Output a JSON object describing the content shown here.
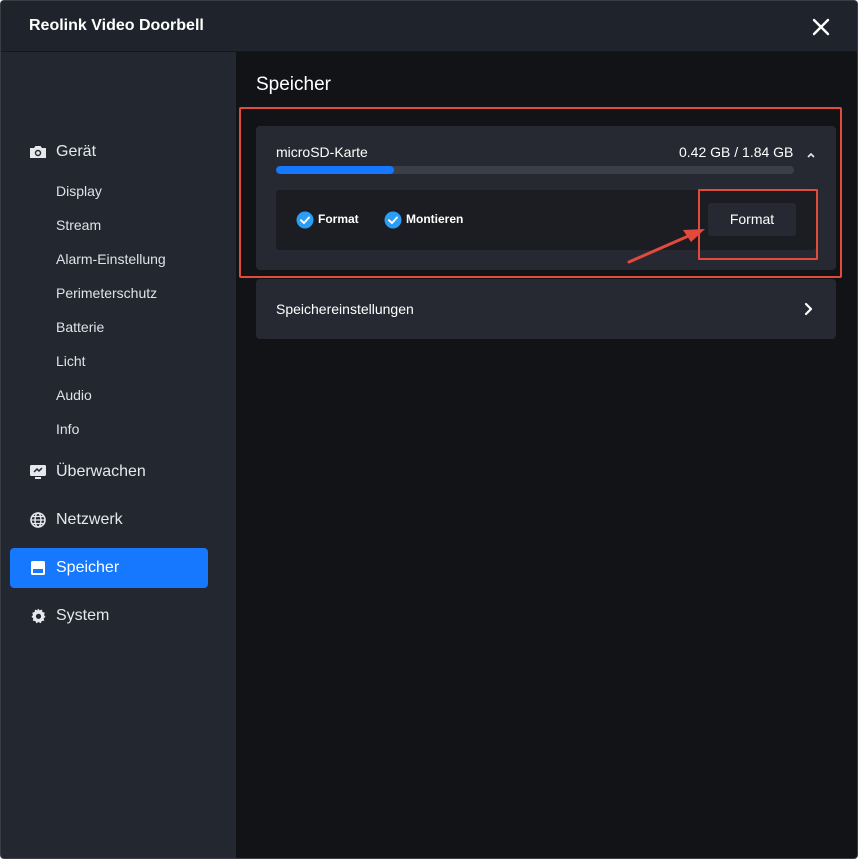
{
  "window": {
    "title": "Reolink Video Doorbell"
  },
  "sidebar": {
    "sections": [
      {
        "label": "Gerät",
        "icon": "camera-icon"
      },
      {
        "label": "Überwachen",
        "icon": "monitor-icon"
      },
      {
        "label": "Netzwerk",
        "icon": "globe-icon"
      },
      {
        "label": "Speicher",
        "icon": "storage-icon",
        "active": true
      },
      {
        "label": "System",
        "icon": "gear-icon"
      }
    ],
    "device_items": [
      "Display",
      "Stream",
      "Alarm-Einstellung",
      "Perimeterschutz",
      "Batterie",
      "Licht",
      "Audio",
      "Info"
    ]
  },
  "main": {
    "title": "Speicher",
    "sd_card": {
      "label": "microSD-Karte",
      "usage": "0.42 GB / 1.84 GB",
      "used_fraction": 0.228,
      "options": [
        {
          "label": "Format",
          "checked": true
        },
        {
          "label": "Montieren",
          "checked": true
        }
      ],
      "format_button": "Format"
    },
    "settings_row": {
      "label": "Speichereinstellungen"
    }
  },
  "colors": {
    "accent": "#1677ff",
    "annotation": "#e24a3b",
    "check": "#2a9df4"
  }
}
